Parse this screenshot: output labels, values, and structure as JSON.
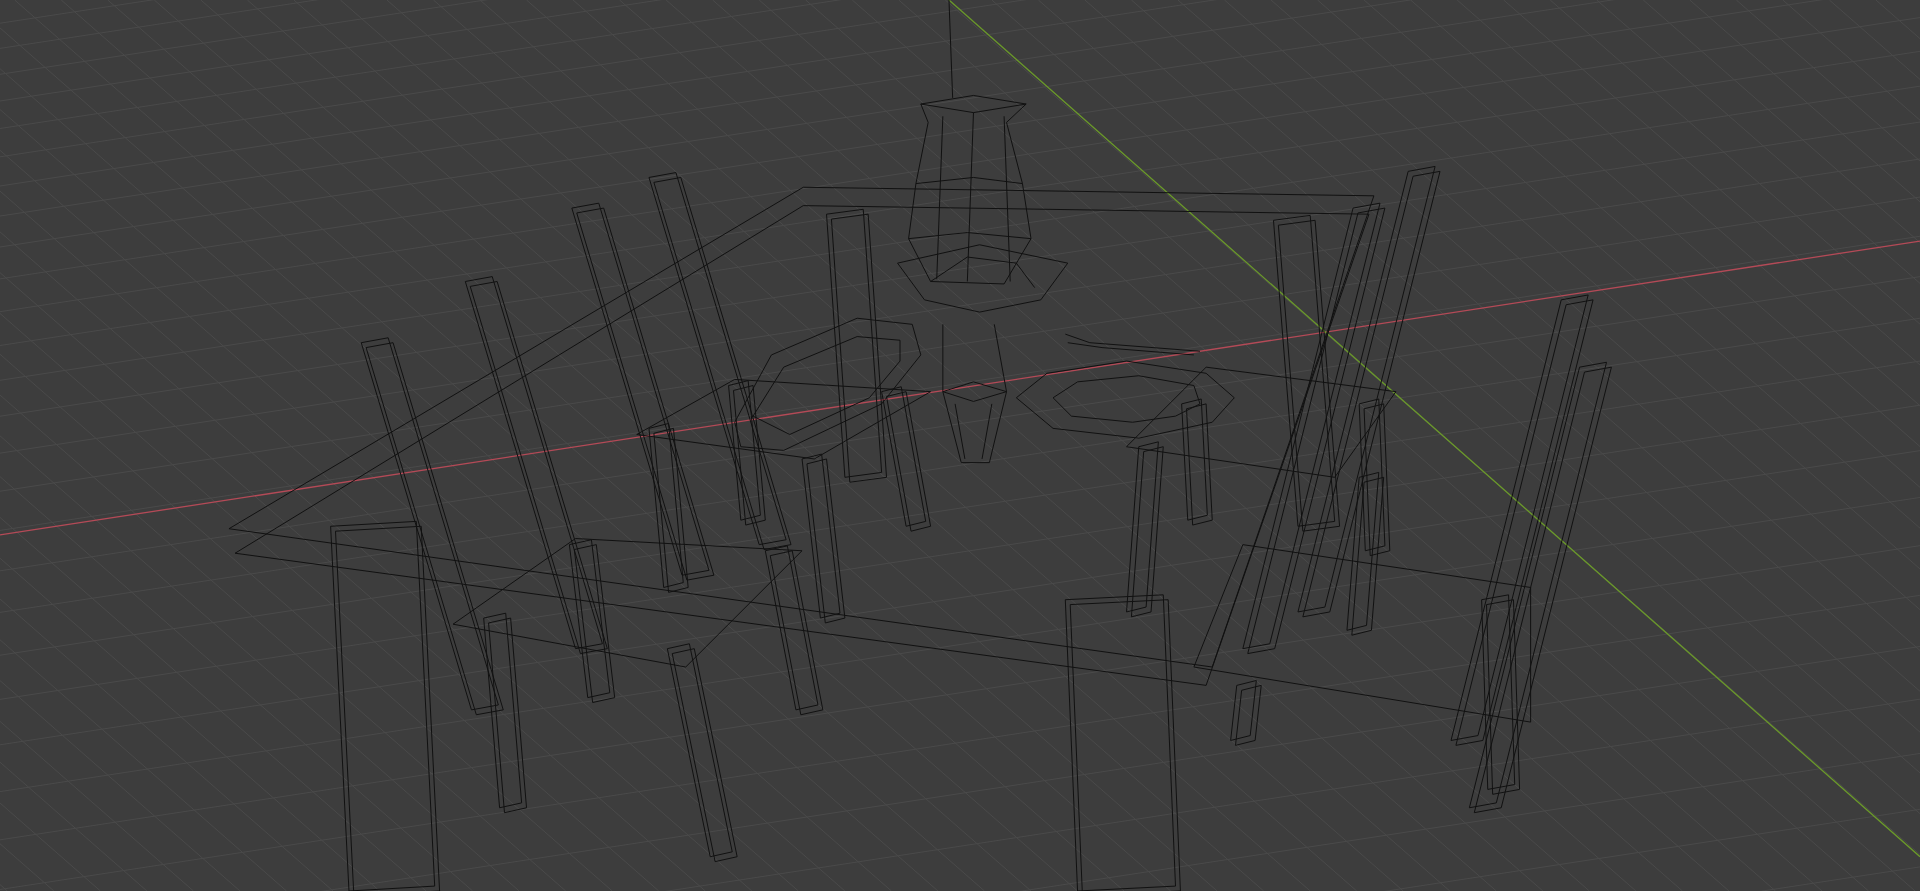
{
  "viewport": {
    "kind": "wireframe",
    "grid": true
  }
}
